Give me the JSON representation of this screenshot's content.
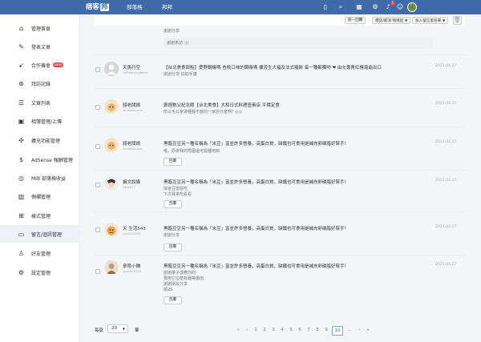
{
  "topbar": {
    "logo_text": "痞客",
    "logo_highlight": "邦",
    "nav": [
      "部落格",
      "邦邦"
    ],
    "notification_count": "1"
  },
  "sidebar": {
    "items": [
      {
        "label": "管理首頁",
        "icon": "home-icon"
      },
      {
        "label": "發表文章",
        "icon": "edit-icon"
      },
      {
        "label": "合作機會",
        "icon": "rocket-icon",
        "badge": "NEW"
      },
      {
        "label": "拜訪記錄",
        "icon": "footprint-icon"
      },
      {
        "label": "文章列表",
        "icon": "list-icon"
      },
      {
        "label": "相簿管理/上傳",
        "icon": "image-icon"
      },
      {
        "label": "擴充功能管理",
        "icon": "puzzle-icon"
      },
      {
        "label": "AdSense 報酬管理",
        "icon": "dollar-icon"
      },
      {
        "label": "MIB 部落格收益",
        "icon": "mib-icon"
      },
      {
        "label": "側欄管理",
        "icon": "columns-icon"
      },
      {
        "label": "樣式管理",
        "icon": "add-square-icon"
      },
      {
        "label": "留言/迴訊管理",
        "icon": "comment-icon",
        "active": true
      },
      {
        "label": "好友管理",
        "icon": "friend-icon"
      },
      {
        "label": "設定管理",
        "icon": "settings-icon"
      }
    ]
  },
  "toolbar": {
    "btn1": "統一回覆",
    "btn2": "標誌/取消 悄悄話",
    "btn3": "加入留言黑名單"
  },
  "first_item": {
    "text": "謝謝分享",
    "reply": "謝謝來訪 :))"
  },
  "comments": [
    {
      "name": "天馬行空",
      "sub": "UnReadingWater",
      "title": "【台北美食部點】愛野鋼嘛嗎 杏桃口味的鋼嘛嗎 擴芳生大福及法式羅餅 每一種都獨吻 ❤ 由允專賣紅檯還龜出口",
      "lines": [
        "謝謝分享  拍拍手讚"
      ],
      "date": "2021.04.27",
      "button": null
    },
    {
      "name": "錢老闆娘",
      "sub": "lolaladarpicit",
      "title": "鄭經數父紀念館【台北美食】大和日式料理壹素店 平價定食",
      "lines": [
        "所以毛公家運種都不變的一家店什麼啊? ◎◎"
      ],
      "date": "2021.04.27",
      "button": null
    },
    {
      "name": "錢老闆娘",
      "sub": "lolaladarpicit",
      "title": "黑醋豆豆另一種名稱為「米豆」富並許多營養，高蛋白質，缺鐵也可食用是補充卵磷脂好幫手！",
      "lines": [
        "哦，原來我的秀園還可提種用西"
      ],
      "date": "2021.04.27",
      "button": "回覆"
    },
    {
      "name": "攝文說攝",
      "sub": "carlt917",
      "title": "黑醋豆豆另一種名稱為「米豆」富並許多營養，高蛋白質，缺鐵也可食用是補充卵磷脂好幫手！",
      "lines": [
        "揭會豆當營吃",
        "下次買來吃看看"
      ],
      "date": "2021.04.27",
      "button": "回覆"
    },
    {
      "name": "天 生活543",
      "sub": "cool100289",
      "title": "黑醋豆豆另一種名稱為「米豆」富並許多營養，高蛋白質，缺鐵也可食用是補充卵磷脂好幫手！",
      "lines": [
        "謝謝分享"
      ],
      "date": "2021.04.27",
      "button": "回覆"
    },
    {
      "name": "參陸小輔",
      "sub": "ppout01509",
      "title": "黑醋豆豆另一種名稱為「米豆」富並許多營養，高蛋白質，缺鐵也可食用是補充卵磷脂好幫手！",
      "lines": [
        "謝謝量子感應你的",
        "要用它這麼有趣等價值",
        "謝謝朋友分享",
        "順25"
      ],
      "date": "2021.04.27",
      "button": "回覆"
    }
  ],
  "pagination": {
    "per_page_label": "每頁",
    "per_page_value": "20",
    "per_page_unit": "筆",
    "pages": [
      "«",
      "‹",
      "1",
      "2",
      "3",
      "4",
      "5",
      "6",
      "7",
      "8",
      "9",
      "10",
      "...",
      "›",
      "»"
    ],
    "current": "10"
  },
  "colors": {
    "topbar": "#3f6ca8",
    "badge": "#e5484d",
    "sidebar_active": "#eef2f7"
  }
}
